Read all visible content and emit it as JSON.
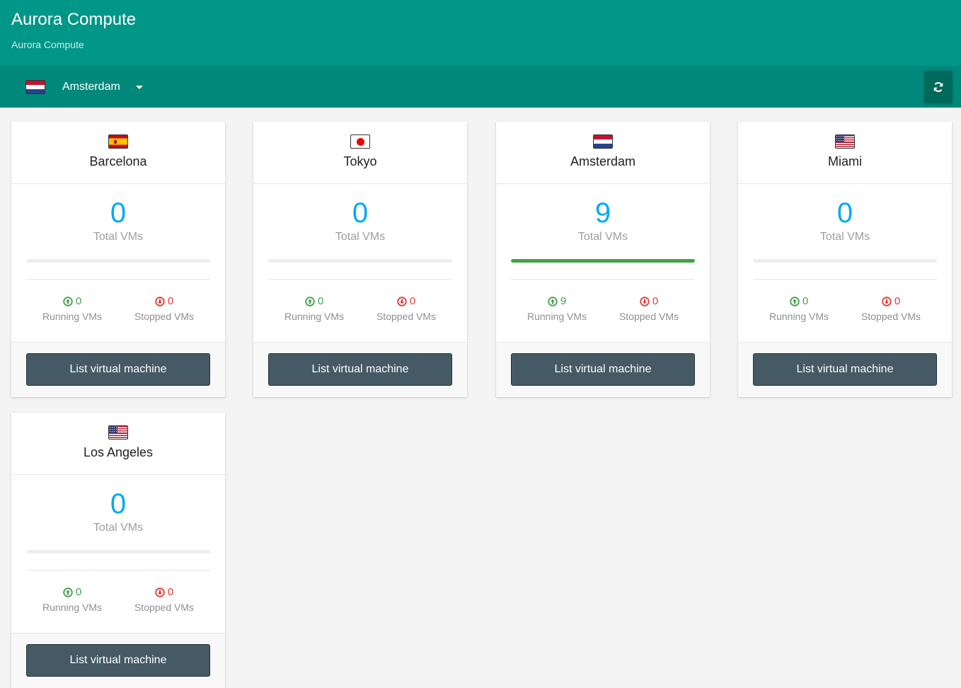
{
  "header": {
    "title": "Aurora Compute",
    "subtitle": "Aurora Compute"
  },
  "region_bar": {
    "selected_region": "Amsterdam",
    "selected_flag": "netherlands-flag",
    "refresh_icon": "refresh-icon"
  },
  "labels": {
    "total": "Total VMs",
    "running": "Running VMs",
    "stopped": "Stopped VMs",
    "list_button": "List virtual machine"
  },
  "colors": {
    "header": "#009688",
    "region_bar": "#00897b",
    "total_number": "#03a9f4",
    "running": "#43a047",
    "stopped": "#e53935",
    "button": "#455a64"
  },
  "regions": [
    {
      "city": "Barcelona",
      "flag": "spain-flag",
      "total": "0",
      "running": "0",
      "stopped": "0",
      "running_fraction": 0
    },
    {
      "city": "Tokyo",
      "flag": "japan-flag",
      "total": "0",
      "running": "0",
      "stopped": "0",
      "running_fraction": 0
    },
    {
      "city": "Amsterdam",
      "flag": "netherlands-flag",
      "total": "9",
      "running": "9",
      "stopped": "0",
      "running_fraction": 1
    },
    {
      "city": "Miami",
      "flag": "usa-flag",
      "total": "0",
      "running": "0",
      "stopped": "0",
      "running_fraction": 0
    },
    {
      "city": "Los Angeles",
      "flag": "usa-flag",
      "total": "0",
      "running": "0",
      "stopped": "0",
      "running_fraction": 0
    }
  ]
}
